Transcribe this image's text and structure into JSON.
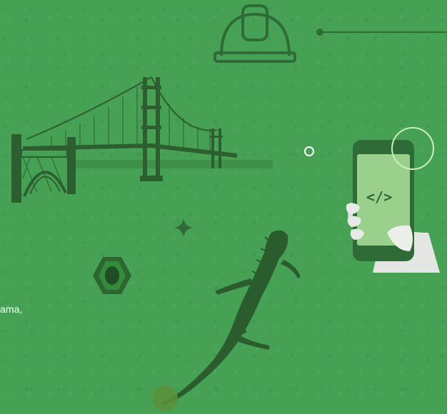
{
  "caption": {
    "text": "ama,"
  },
  "phone": {
    "code_glyph": "</>"
  },
  "icons": {
    "helmet": "hard-hat-icon",
    "bridge": "golden-gate-bridge-illustration",
    "phone": "phone-in-hand-illustration",
    "nut": "hex-nut-illustration",
    "lizard": "lizard-illustration",
    "sparkle": "sparkle-icon",
    "ring": "ring-decoration-icon"
  },
  "colors": {
    "background": "#46a154",
    "dark_green": "#2f6b36",
    "phone_screen": "#9ad08b",
    "ring_light": "#c9f0b7"
  }
}
